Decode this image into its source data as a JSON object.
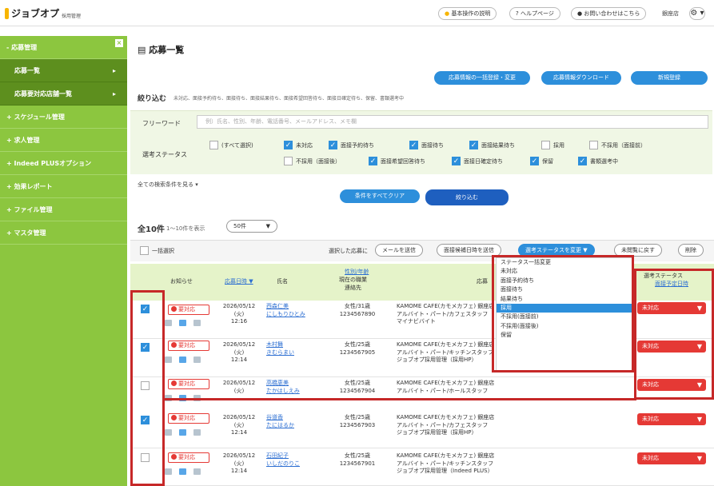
{
  "header": {
    "logo": "ジョブオプ",
    "logo_sub": "採用管理",
    "guide": "基本操作の説明",
    "help": "ヘルプページ",
    "contact": "お問い合わせはこちら",
    "shop": "銀座店",
    "gear": "⚙ ▾"
  },
  "sidebar": {
    "collapse": "×",
    "items": [
      {
        "label": "- 応募管理"
      },
      {
        "label": "応募一覧",
        "arrow": "▸"
      },
      {
        "label": "応募要対応店舗一覧",
        "arrow": "▸"
      },
      {
        "label": "+ スケジュール管理"
      },
      {
        "label": "+ 求人管理"
      },
      {
        "label": "+ Indeed PLUSオプション"
      },
      {
        "label": "+ 効果レポート"
      },
      {
        "label": "+ ファイル管理"
      },
      {
        "label": "+ マスタ管理"
      }
    ]
  },
  "page": {
    "title": "応募一覧",
    "btn_bulk_edit": "応募情報の一括登録・変更",
    "btn_download": "応募情報ダウンロード",
    "btn_new": "新規登録"
  },
  "filter": {
    "title": "絞り込む",
    "desc": "未対応、面接予約待ち、面接待ち、面接結果待ち、面接希望回答待ち、面接日確定待ち、保留、書類選考中",
    "keyword_label": "フリーワード",
    "keyword_placeholder": "例）氏名、性別、年齢、電話番号、メールアドレス、メモ欄",
    "status_label": "選考ステータス",
    "checkboxes": [
      {
        "label": "(すべて選択)",
        "checked": false
      },
      {
        "label": "未対応",
        "checked": true
      },
      {
        "label": "面接予約待ち",
        "checked": true
      },
      {
        "label": "面接待ち",
        "checked": true
      },
      {
        "label": "面接結果待ち",
        "checked": true
      },
      {
        "label": "採用",
        "checked": false
      },
      {
        "label": "不採用（面接前）",
        "checked": false
      },
      {
        "label": "不採用（面接後）",
        "checked": false
      },
      {
        "label": "面接希望回答待ち",
        "checked": true
      },
      {
        "label": "面接日確定待ち",
        "checked": true
      },
      {
        "label": "保留",
        "checked": true
      },
      {
        "label": "書類選考中",
        "checked": true
      }
    ],
    "see_all": "全ての検索条件を見る ▾",
    "clear": "条件をすべてクリア",
    "apply": "絞り込む"
  },
  "results": {
    "count": "全10件",
    "range": "1〜10件を表示",
    "per_page": "50件",
    "per_page_arrow": "▼"
  },
  "bulk": {
    "select_all": "一括選択",
    "selected_text": "選択した応募に",
    "send_mail": "メールを送信",
    "send_interview": "面接候補日時を送信",
    "change_status": "選考ステータスを変更 ▼",
    "mark_unread": "未閲覧に戻す",
    "delete": "削除"
  },
  "table": {
    "col_notice": "お知らせ",
    "col_date": "応募日時 ▼",
    "col_name": "氏名",
    "col_gender": "性別/年齢",
    "col_job": "現在の職業",
    "col_contact": "連絡先",
    "col_shop": "応募",
    "col_status": "選考ステータス",
    "col_schedule": "面接予定日時",
    "rows": [
      {
        "checked": true,
        "notice": "要対応",
        "date": "2026/05/12",
        "dow": "(火)",
        "time": "12:16",
        "kanji": "西森仁美",
        "kana": "にしもりひとみ",
        "gender": "女性/31歳",
        "tel": "1234567890",
        "shop": "KAMOME CAFE(カモメカフェ) 銀座店",
        "job": "アルバイト・パート/カフェスタッフ",
        "source": "マイナビバイト",
        "status": "未対応",
        "status_arrow": "▼"
      },
      {
        "checked": true,
        "notice": "要対応",
        "date": "2026/05/12",
        "dow": "(火)",
        "time": "12:14",
        "kanji": "木村舞",
        "kana": "きむらまい",
        "gender": "女性/25歳",
        "tel": "1234567905",
        "shop": "KAMOME CAFE(カモメカフェ) 銀座店",
        "job": "アルバイト・パート/キッチンスタッフ",
        "source": "ジョブオプ採用管理（採用HP）",
        "status": "未対応",
        "status_arrow": "▼"
      },
      {
        "checked": false,
        "notice": "要対応",
        "date": "2026/05/12",
        "dow": "(火)",
        "time": "",
        "kanji": "高橋恵美",
        "kana": "たかはしえみ",
        "gender": "女性/25歳",
        "tel": "1234567904",
        "shop": "KAMOME CAFE(カモメカフェ) 銀座店",
        "job": "アルバイト・パート/ホールスタッフ",
        "source": "",
        "status": "未対応",
        "status_arrow": "▼"
      },
      {
        "checked": true,
        "notice": "要対応",
        "date": "2026/05/12",
        "dow": "(火)",
        "time": "12:14",
        "kanji": "谷道香",
        "kana": "たにはるか",
        "gender": "女性/25歳",
        "tel": "1234567903",
        "shop": "KAMOME CAFE(カモメカフェ) 銀座店",
        "job": "アルバイト・パート/カフェスタッフ",
        "source": "ジョブオプ採用管理（採用HP）",
        "status": "未対応",
        "status_arrow": "▼"
      },
      {
        "checked": false,
        "notice": "要対応",
        "date": "2026/05/12",
        "dow": "(火)",
        "time": "12:14",
        "kanji": "石田紀子",
        "kana": "いしだのりこ",
        "gender": "女性/25歳",
        "tel": "1234567901",
        "shop": "KAMOME CAFE(カモメカフェ) 銀座店",
        "job": "アルバイト・パート/キッチンスタッフ",
        "source": "ジョブオプ採用管理（Indeed PLUS）",
        "status": "未対応",
        "status_arrow": "▼"
      }
    ]
  },
  "status_dropdown": {
    "items": [
      "ステータス一括変更",
      "未対応",
      "面接予約待ち",
      "面接待ち",
      "結果待ち",
      "採用",
      "不採用(面接前)",
      "不採用(面接後)",
      "保留"
    ],
    "selected_index": 5
  },
  "colors": {
    "sidebar_green": "#8cc63f",
    "accent_blue": "#2d8fdb",
    "alert_red": "#e53935",
    "highlight_red": "#c62828"
  }
}
